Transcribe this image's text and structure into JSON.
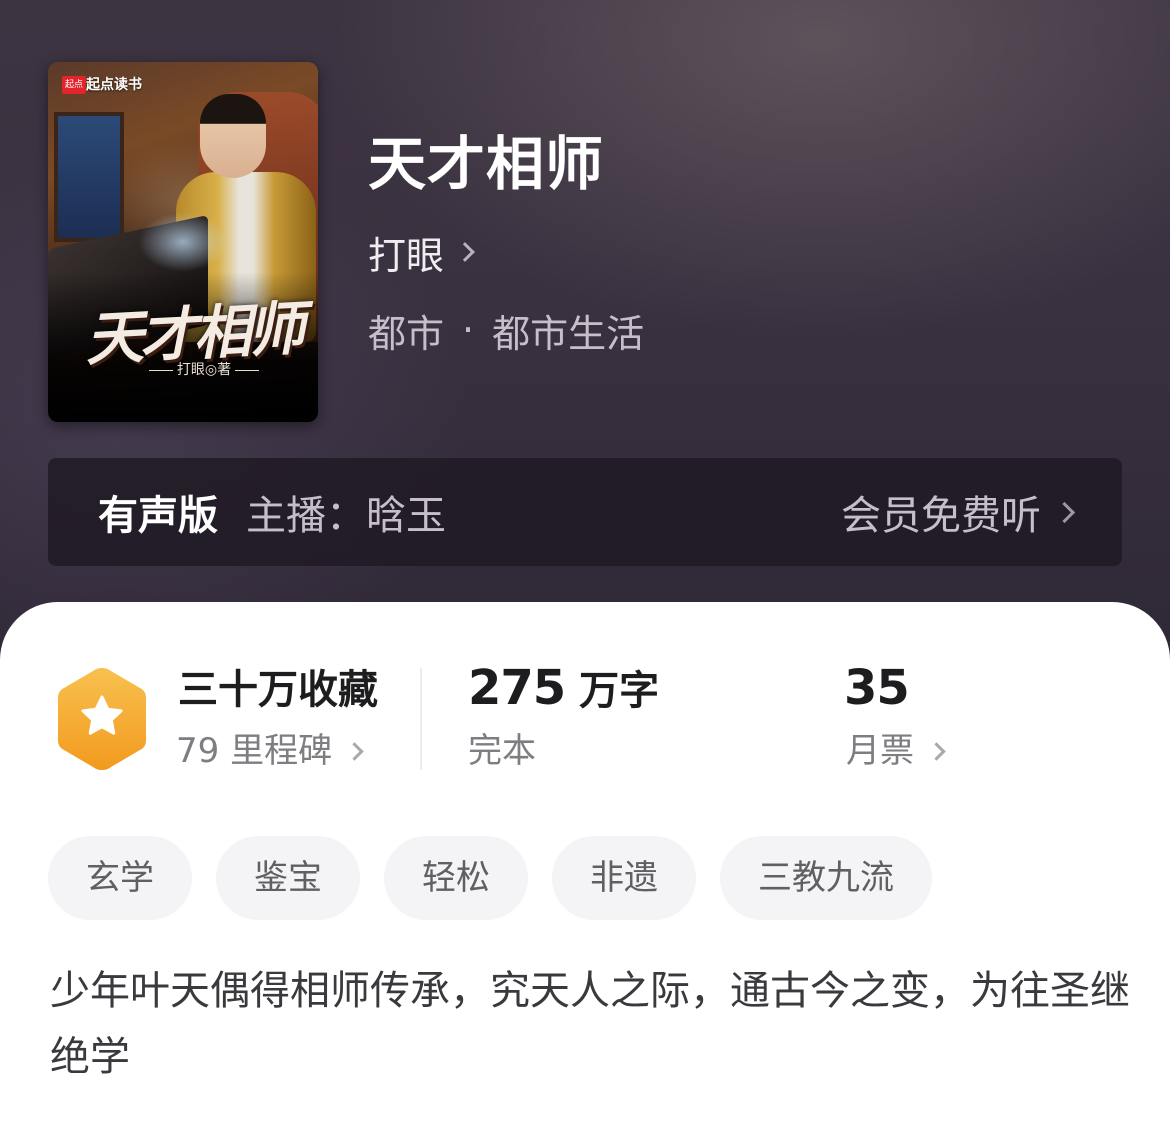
{
  "book": {
    "title": "天才相师",
    "author": "打眼",
    "category": "都市",
    "separator": "·",
    "subcategory": "都市生活",
    "cover": {
      "publisher_badge": "起点",
      "publisher_name": "起点读书",
      "cover_title": "天才相师",
      "cover_author": "打眼◎著"
    }
  },
  "audio": {
    "label": "有声版",
    "narrator": "主播：晗玉",
    "action": "会员免费听"
  },
  "stats": {
    "collections": "三十万收藏",
    "milestones": "79 里程碑",
    "word_count_number": "275",
    "word_count_unit": "万字",
    "status": "完本",
    "monthly_tickets": "35",
    "monthly_tickets_label": "月票"
  },
  "tags": [
    "玄学",
    "鉴宝",
    "轻松",
    "非遗",
    "三教九流"
  ],
  "description": "少年叶天偶得相师传承，究天人之际，通古今之变，为往圣继绝学",
  "colors": {
    "hero_bg": "#3a3140",
    "badge_orange": "#f5a623",
    "tag_bg": "#f4f4f6"
  }
}
